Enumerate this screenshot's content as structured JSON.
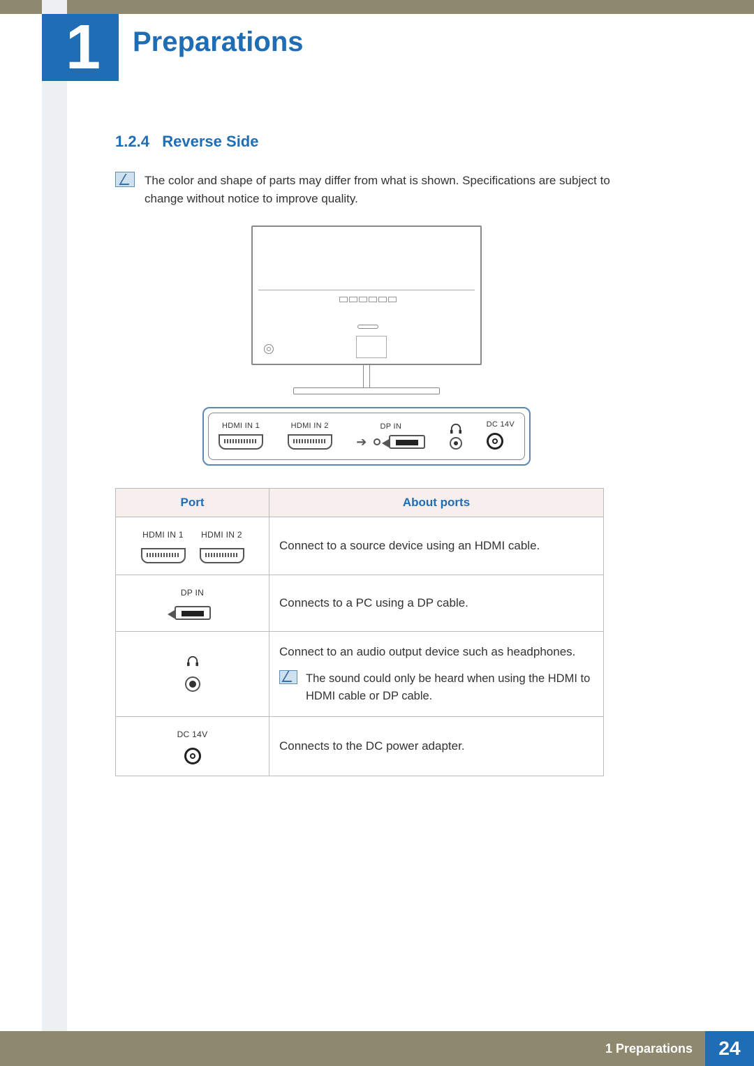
{
  "chapter": {
    "number": "1",
    "title": "Preparations"
  },
  "section": {
    "number": "1.2.4",
    "title": "Reverse Side"
  },
  "note_text": "The color and shape of parts may differ from what is shown. Specifications are subject to change without notice to improve quality.",
  "port_labels": {
    "hdmi1": "HDMI IN 1",
    "hdmi2": "HDMI IN 2",
    "dp": "DP IN",
    "dc": "DC 14V"
  },
  "table": {
    "headers": {
      "port": "Port",
      "about": "About ports"
    },
    "rows": {
      "hdmi": "Connect to a source device using an HDMI cable.",
      "dp": "Connects to a PC using a DP cable.",
      "hp": "Connect to an audio output device such as headphones.",
      "hp_note": "The sound could only be heard when using the HDMI to HDMI cable or DP cable.",
      "dc": "Connects to the DC power adapter."
    }
  },
  "footer": {
    "chapter_label": "1 Preparations",
    "page": "24"
  }
}
